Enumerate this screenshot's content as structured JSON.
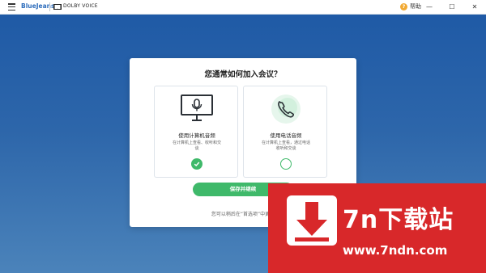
{
  "titlebar": {
    "brand": "BlueJeans",
    "dolby": "DOLBY VOICE",
    "help_label": "帮助",
    "help_glyph": "?",
    "min_glyph": "—",
    "max_glyph": "☐",
    "close_glyph": "✕"
  },
  "dialog": {
    "title": "您通常如何加入会议？",
    "options": [
      {
        "label": "使用计算机音频",
        "description": "在计算机上查看、收听和交谈",
        "selected": true,
        "icon": "monitor-microphone-icon"
      },
      {
        "label": "使用电话音频",
        "description": "在计算机上查看，通过电话收听和交谈",
        "selected": false,
        "icon": "phone-icon"
      }
    ],
    "save_label": "保存并继续",
    "hint": "您可以稍后在“首选项”中更改"
  },
  "watermark": {
    "title": "7n下载站",
    "url": "www.7ndn.com"
  },
  "colors": {
    "accent_green": "#3fb96a",
    "brand_blue": "#2f6ebc",
    "background_blue": "#2d66aa",
    "watermark_red": "#d8282a"
  }
}
